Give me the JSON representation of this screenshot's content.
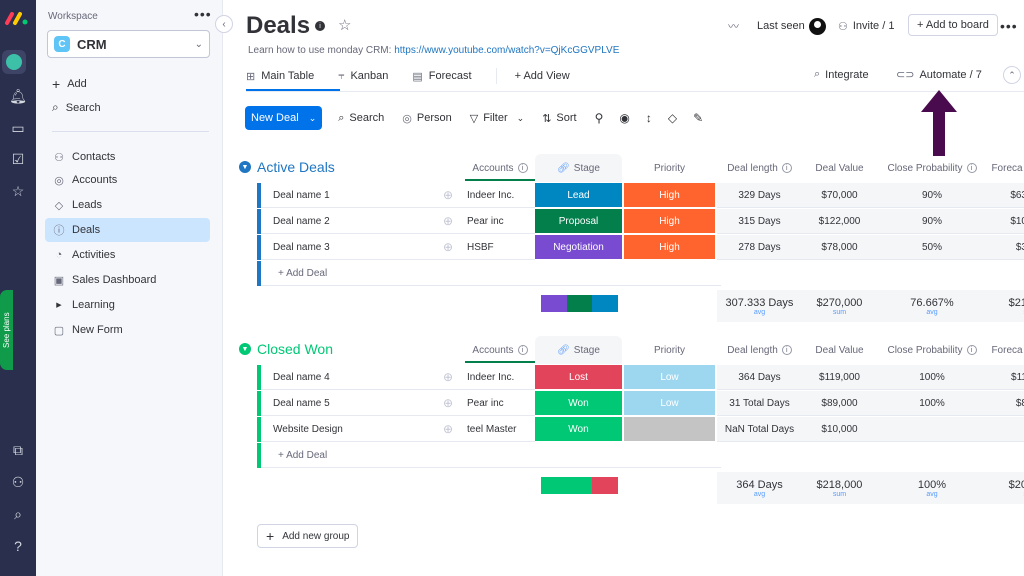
{
  "rail": {
    "icons": [
      "monday-logo",
      "workspace-icon",
      "bell-icon",
      "inbox-icon",
      "my-work-icon",
      "favorites-icon",
      "apps-icon",
      "invite-icon",
      "search-icon",
      "help-icon"
    ],
    "see_plans": "See plans"
  },
  "workspace": {
    "label": "Workspace",
    "name": "CRM",
    "badge": "C",
    "actions": [
      {
        "icon": "plus-icon",
        "label": "Add"
      },
      {
        "icon": "search-icon",
        "label": "Search"
      }
    ],
    "items": [
      {
        "icon": "contacts-icon",
        "label": "Contacts",
        "active": false
      },
      {
        "icon": "accounts-icon",
        "label": "Accounts",
        "active": false
      },
      {
        "icon": "leads-icon",
        "label": "Leads",
        "active": false
      },
      {
        "icon": "deals-icon",
        "label": "Deals",
        "active": true
      },
      {
        "icon": "activities-icon",
        "label": "Activities",
        "active": false
      },
      {
        "icon": "dashboard-icon",
        "label": "Sales Dashboard",
        "active": false
      },
      {
        "icon": "folder-caret-icon",
        "label": "Learning",
        "active": false
      },
      {
        "icon": "form-icon",
        "label": "New Form",
        "active": false
      }
    ]
  },
  "header": {
    "title": "Deals",
    "description_prefix": "Learn how to use monday CRM:",
    "description_link": "https://www.youtube.com/watch?v=QjKcGGVPLVE",
    "last_seen": "Last seen",
    "invite": "Invite / 1",
    "add_to_board": "+ Add to board",
    "integrate": "Integrate",
    "automate": "Automate / 7"
  },
  "tabs": [
    {
      "label": "Main Table",
      "active": true
    },
    {
      "label": "Kanban",
      "active": false
    },
    {
      "label": "Forecast",
      "active": false
    }
  ],
  "add_view": "+ Add View",
  "toolbar": {
    "new_deal": "New Deal",
    "search": "Search",
    "person": "Person",
    "filter": "Filter",
    "sort": "Sort"
  },
  "columns": {
    "accounts": "Accounts",
    "stage": "Stage",
    "priority": "Priority",
    "deal_length": "Deal length",
    "deal_value": "Deal Value",
    "close_probability": "Close Probability",
    "forecast": "Foreca"
  },
  "groups": [
    {
      "title": "Active Deals",
      "color": "#1f76c2",
      "rows": [
        {
          "name": "Deal name 1",
          "account": "Indeer Inc.",
          "stage": "Lead",
          "stage_color": "#0086c0",
          "priority": "High",
          "priority_color": "#ff642e",
          "deal_length": "329 Days",
          "deal_value": "$70,000",
          "close_probability": "90%",
          "forecast": "$63"
        },
        {
          "name": "Deal name 2",
          "account": "Pear inc",
          "stage": "Proposal",
          "stage_color": "#037f4c",
          "priority": "High",
          "priority_color": "#ff642e",
          "deal_length": "315 Days",
          "deal_value": "$122,000",
          "close_probability": "90%",
          "forecast": "$10"
        },
        {
          "name": "Deal name 3",
          "account": "HSBF",
          "stage": "Negotiation",
          "stage_color": "#784bd1",
          "priority": "High",
          "priority_color": "#ff642e",
          "deal_length": "278 Days",
          "deal_value": "$78,000",
          "close_probability": "50%",
          "forecast": "$3"
        }
      ],
      "add_label": "+ Add Deal",
      "stage_summary": [
        {
          "color": "#784bd1",
          "fraction": 0.333
        },
        {
          "color": "#037f4c",
          "fraction": 0.333
        },
        {
          "color": "#0086c0",
          "fraction": 0.334
        }
      ],
      "summary": {
        "deal_length": "307.333 Days",
        "deal_length_fn": "avg",
        "deal_value": "$270,000",
        "deal_value_fn": "sum",
        "close_probability": "76.667%",
        "close_probability_fn": "avg",
        "forecast": "$21",
        "forecast_fn": "s"
      }
    },
    {
      "title": "Closed Won",
      "color": "#00c875",
      "rows": [
        {
          "name": "Deal name 4",
          "account": "Indeer Inc.",
          "stage": "Lost",
          "stage_color": "#e2445c",
          "priority": "Low",
          "priority_color": "#9cd7ef",
          "deal_length": "364 Days",
          "deal_value": "$119,000",
          "close_probability": "100%",
          "forecast": "$11"
        },
        {
          "name": "Deal name 5",
          "account": "Pear inc",
          "stage": "Won",
          "stage_color": "#00c875",
          "priority": "Low",
          "priority_color": "#9cd7ef",
          "deal_length": "31 Total Days",
          "deal_value": "$89,000",
          "close_probability": "100%",
          "forecast": "$8"
        },
        {
          "name": "Website Design",
          "account": "teel Master",
          "stage": "Won",
          "stage_color": "#00c875",
          "priority": "",
          "priority_color": "#c4c4c4",
          "deal_length": "NaN Total Days",
          "deal_value": "$10,000",
          "close_probability": "",
          "forecast": ""
        }
      ],
      "add_label": "+ Add Deal",
      "stage_summary": [
        {
          "color": "#00c875",
          "fraction": 0.667
        },
        {
          "color": "#e2445c",
          "fraction": 0.333
        }
      ],
      "summary": {
        "deal_length": "364 Days",
        "deal_length_fn": "avg",
        "deal_value": "$218,000",
        "deal_value_fn": "sum",
        "close_probability": "100%",
        "close_probability_fn": "avg",
        "forecast": "$20",
        "forecast_fn": "s"
      }
    }
  ],
  "add_new_group": "Add new group",
  "annotation": {
    "type": "arrow-up",
    "color": "#4a0a4e",
    "points_to": "Automate / 7"
  }
}
